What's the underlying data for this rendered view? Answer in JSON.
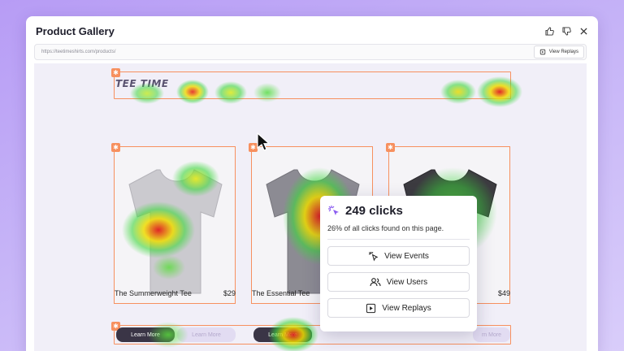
{
  "window": {
    "title": "Product Gallery"
  },
  "toolbar": {
    "url": "https://teetimeshirts.com/products/",
    "view_replays_label": "View Replays"
  },
  "site": {
    "logo": "TEE TIME"
  },
  "products": [
    {
      "name": "The Summerweight Tee",
      "price": "$29",
      "color": "#c9c8cc"
    },
    {
      "name": "The Essential Tee",
      "price": "",
      "color": "#8a8991"
    },
    {
      "name": "",
      "price": "$49",
      "color": "#3b3a3f"
    }
  ],
  "buttons": {
    "learn_more": "Learn More",
    "learn_more_partial": "rn More"
  },
  "popup": {
    "clicks": "249 clicks",
    "summary": "26% of all clicks found on this page.",
    "view_events": "View Events",
    "view_users": "View Users",
    "view_replays": "View Replays"
  },
  "colors": {
    "accent": "#f7905f",
    "heat_high": "#e01e1e",
    "heat_mid": "#f0e000",
    "heat_low": "#2fd42f"
  }
}
